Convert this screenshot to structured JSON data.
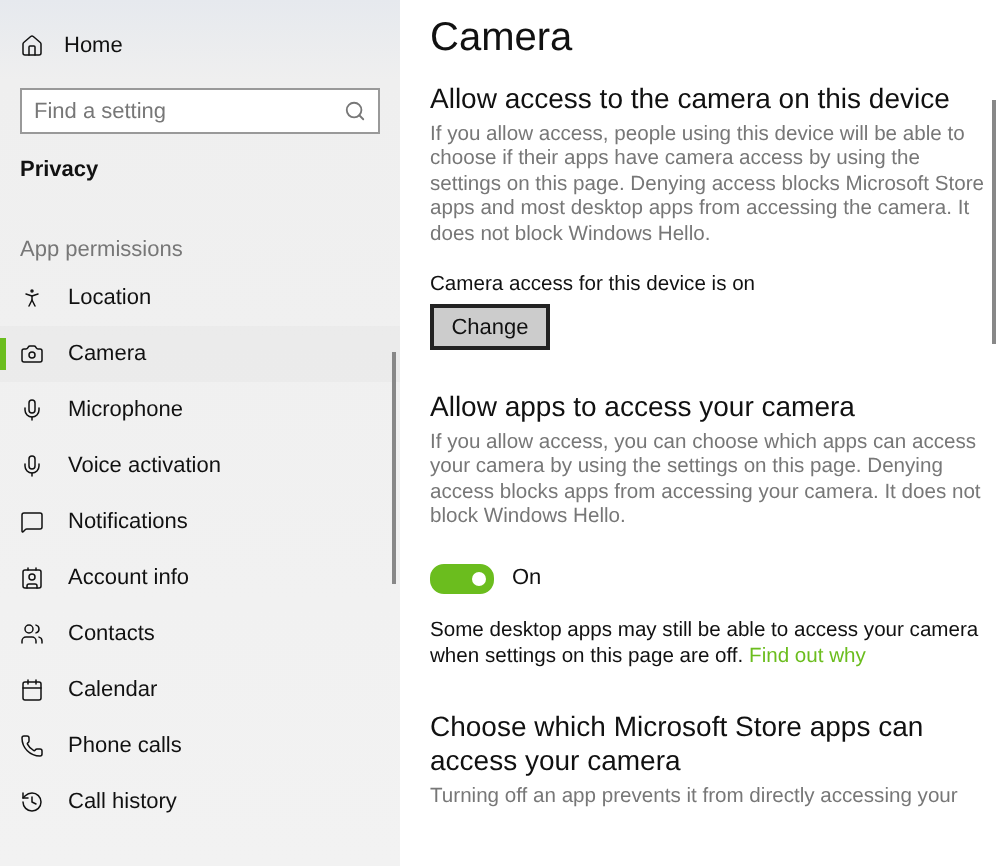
{
  "sidebar": {
    "home": "Home",
    "search": {
      "placeholder": "Find a setting"
    },
    "section": "Privacy",
    "group": "App permissions",
    "items": [
      {
        "label": "Location",
        "selected": false
      },
      {
        "label": "Camera",
        "selected": true
      },
      {
        "label": "Microphone",
        "selected": false
      },
      {
        "label": "Voice activation",
        "selected": false
      },
      {
        "label": "Notifications",
        "selected": false
      },
      {
        "label": "Account info",
        "selected": false
      },
      {
        "label": "Contacts",
        "selected": false
      },
      {
        "label": "Calendar",
        "selected": false
      },
      {
        "label": "Phone calls",
        "selected": false
      },
      {
        "label": "Call history",
        "selected": false
      }
    ]
  },
  "page": {
    "title": "Camera",
    "device_section": {
      "heading": "Allow access to the camera on this device",
      "description": "If you allow access, people using this device will be able to choose if their apps have camera access by using the settings on this page. Denying access blocks Microsoft Store apps and most desktop apps from accessing the camera. It does not block Windows Hello.",
      "status": "Camera access for this device is on",
      "button": "Change"
    },
    "apps_section": {
      "heading": "Allow apps to access your camera",
      "description": "If you allow access, you can choose which apps can access your camera by using the settings on this page. Denying access blocks apps from accessing your camera. It does not block Windows Hello.",
      "toggle": {
        "on": true,
        "label": "On"
      },
      "note": "Some desktop apps may still be able to access your camera when settings on this page are off.",
      "link": "Find out why"
    },
    "store_section": {
      "heading": "Choose which Microsoft Store apps can access your camera",
      "description": "Turning off an app prevents it from directly accessing your"
    }
  }
}
